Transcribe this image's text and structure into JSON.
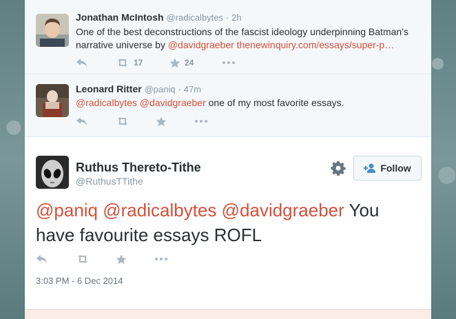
{
  "tweets": [
    {
      "name": "Jonathan McIntosh",
      "handle": "@radicalbytes",
      "separator": "·",
      "time": "2h",
      "mention": "@davidgraeber",
      "text_before": "One of the best deconstructions of the fascist ideology underpinning Batman's narrative universe by ",
      "link": "thenewinquiry.com/essays/super-p…",
      "retweets": "17",
      "favorites": "24"
    },
    {
      "name": "Leonard Ritter",
      "handle": "@paniq",
      "separator": "·",
      "time": "47m",
      "mention1": "@radicalbytes",
      "mention2": "@davidgraeber",
      "text_after": " one of my most favorite essays."
    }
  ],
  "main_tweet": {
    "name": "Ruthus Thereto-Tithe",
    "handle": "@RuthusTTithe",
    "follow_label": "Follow",
    "mention1": "@paniq",
    "mention2": "@radicalbytes",
    "mention3": "@davidgraeber",
    "text_after": " You have favourite essays ROFL",
    "timestamp": "3:03 PM - 6 Dec 2014"
  },
  "colors": {
    "link": "#d5503a",
    "icon": "#aab8c2"
  },
  "icons": [
    "reply-icon",
    "retweet-icon",
    "favorite-icon",
    "more-icon",
    "gear-icon",
    "follow-user-icon"
  ]
}
